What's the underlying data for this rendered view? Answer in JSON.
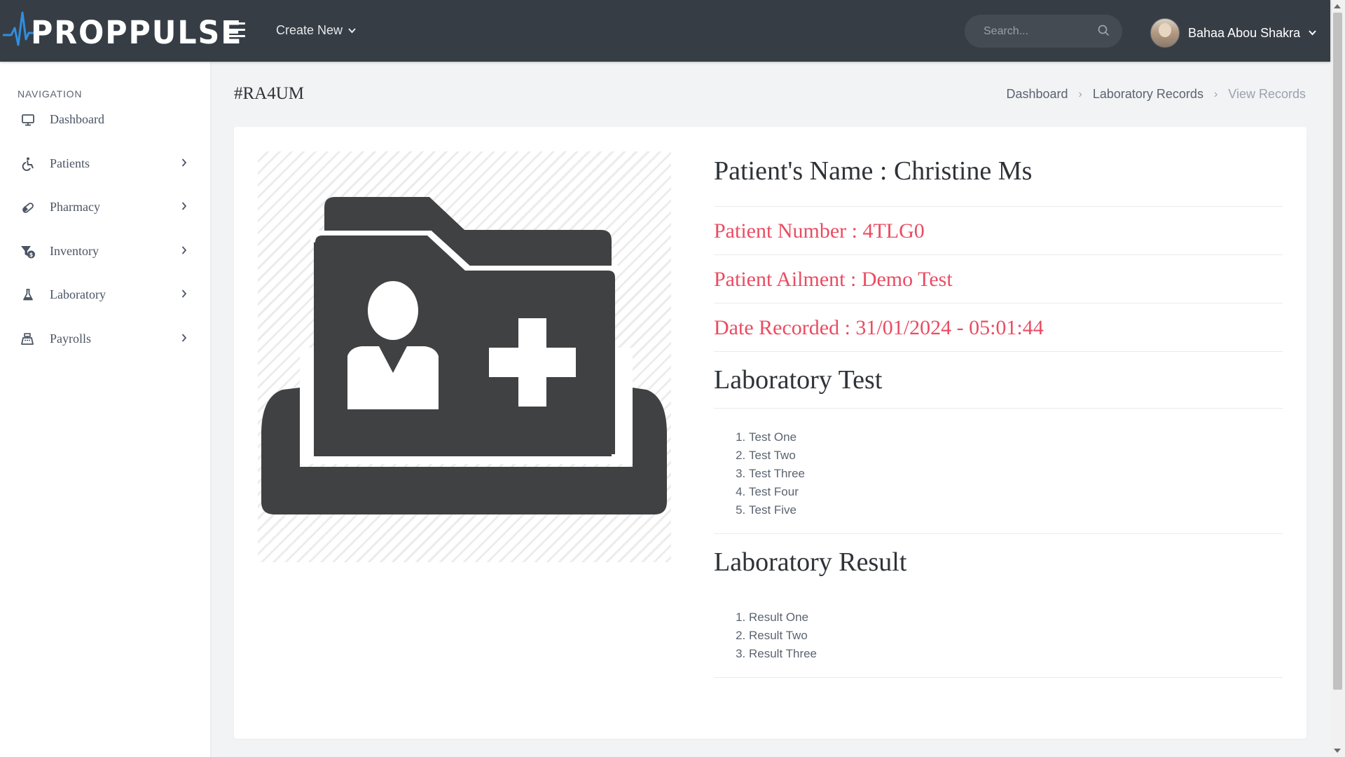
{
  "header": {
    "logo_text": "PROPPULSE",
    "create_new_label": "Create New",
    "search_placeholder": "Search...",
    "user_name": "Bahaa Abou Shakra"
  },
  "sidebar": {
    "title": "NAVIGATION",
    "items": [
      {
        "label": "Dashboard",
        "icon": "monitor-icon",
        "has_submenu": false
      },
      {
        "label": "Patients",
        "icon": "wheelchair-icon",
        "has_submenu": true
      },
      {
        "label": "Pharmacy",
        "icon": "pill-icon",
        "has_submenu": true
      },
      {
        "label": "Inventory",
        "icon": "funnel-dollar-icon",
        "has_submenu": true
      },
      {
        "label": "Laboratory",
        "icon": "flask-icon",
        "has_submenu": true
      },
      {
        "label": "Payrolls",
        "icon": "cash-register-icon",
        "has_submenu": true
      }
    ]
  },
  "page": {
    "id": "#RA4UM",
    "breadcrumb": [
      "Dashboard",
      "Laboratory Records",
      "View Records"
    ]
  },
  "record": {
    "patient_name": "Patient's Name : Christine Ms",
    "patient_number": "Patient Number : 4TLG0",
    "patient_ailment": "Patient Ailment : Demo Test",
    "date_recorded": "Date Recorded : 31/01/2024 - 05:01:44",
    "lab_test_heading": "Laboratory Test",
    "lab_tests": [
      "Test One",
      "Test Two",
      "Test Three",
      "Test Four",
      "Test Five"
    ],
    "lab_result_heading": "Laboratory Result",
    "lab_results": [
      "Result One",
      "Result Two",
      "Result Three"
    ]
  },
  "colors": {
    "topbar": "#373d45",
    "accent_red": "#ea4c62",
    "pulse_blue": "#2f8ee0",
    "page_bg": "#f2f3f5"
  }
}
